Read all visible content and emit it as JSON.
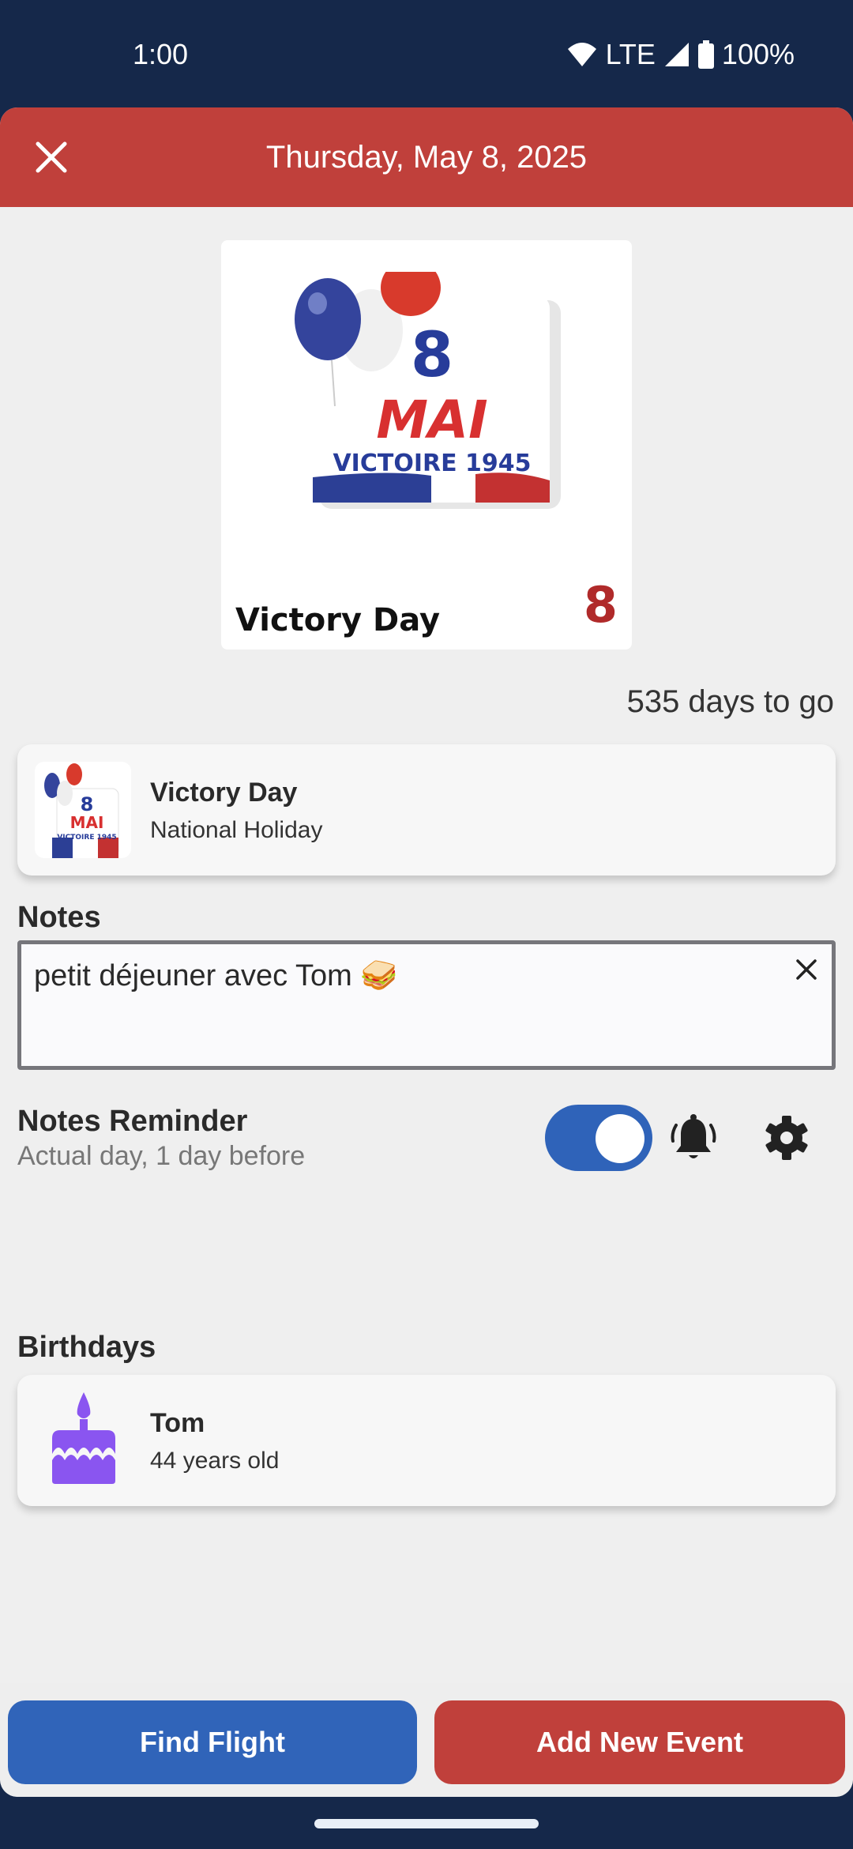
{
  "status_bar": {
    "time": "1:00",
    "network": "LTE",
    "battery": "100%",
    "icons": [
      "wifi-icon",
      "signal-icon",
      "battery-icon"
    ]
  },
  "header": {
    "title": "Thursday, May 8, 2025",
    "close_icon": "close-icon"
  },
  "hero": {
    "image_text_day": "8",
    "image_text_month": "MAI",
    "image_text_caption": "VICTOIRE 1945",
    "title": "Victory Day",
    "day_number": "8"
  },
  "countdown": "535 days to go",
  "event": {
    "title": "Victory Day",
    "subtitle": "National Holiday",
    "thumb_day": "8",
    "thumb_month": "MAI",
    "thumb_caption": "VICTOIRE 1945"
  },
  "notes": {
    "label": "Notes",
    "value": "petit déjeuner avec Tom 🥪"
  },
  "reminder": {
    "title": "Notes Reminder",
    "subtitle": "Actual day, 1 day before",
    "enabled": true
  },
  "birthdays": {
    "label": "Birthdays",
    "items": [
      {
        "name": "Tom",
        "age": "44 years old"
      }
    ]
  },
  "actions": {
    "find_flight": "Find Flight",
    "add_event": "Add New Event"
  },
  "colors": {
    "status_bar": "#15284a",
    "header": "#c0403b",
    "primary_blue": "#3064b9",
    "accent_red": "#c0403b",
    "cake_purple": "#8a55f0"
  }
}
